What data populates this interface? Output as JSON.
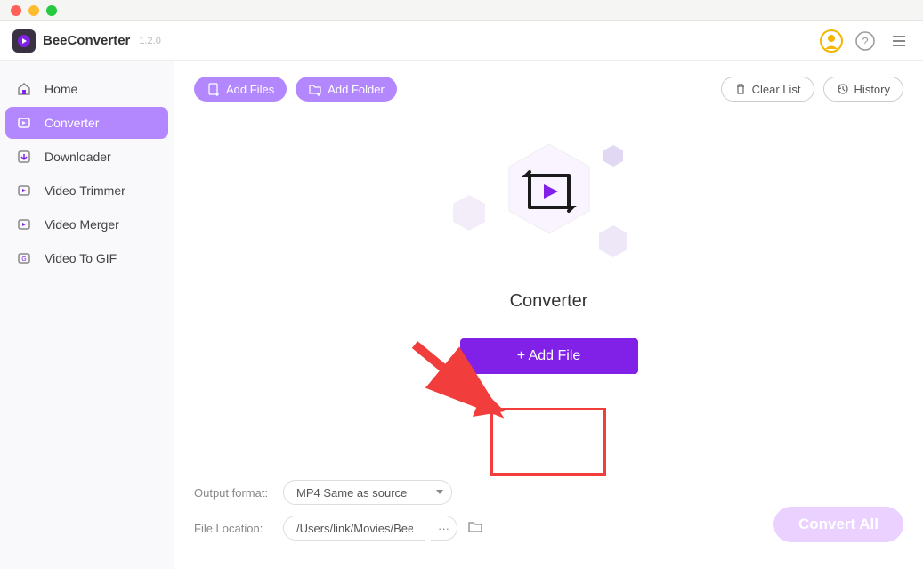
{
  "app": {
    "name": "BeeConverter",
    "version": "1.2.0"
  },
  "sidebar": {
    "items": [
      {
        "label": "Home"
      },
      {
        "label": "Converter"
      },
      {
        "label": "Downloader"
      },
      {
        "label": "Video Trimmer"
      },
      {
        "label": "Video Merger"
      },
      {
        "label": "Video To GIF"
      }
    ]
  },
  "toolbar": {
    "add_files": "Add Files",
    "add_folder": "Add Folder",
    "clear_list": "Clear List",
    "history": "History"
  },
  "main": {
    "title": "Converter",
    "add_file_label": "+ Add File"
  },
  "footer": {
    "output_format_label": "Output format:",
    "output_format_value": "MP4 Same as source",
    "file_location_label": "File Location:",
    "file_location_value": "/Users/link/Movies/BeeC",
    "convert_all": "Convert All"
  }
}
